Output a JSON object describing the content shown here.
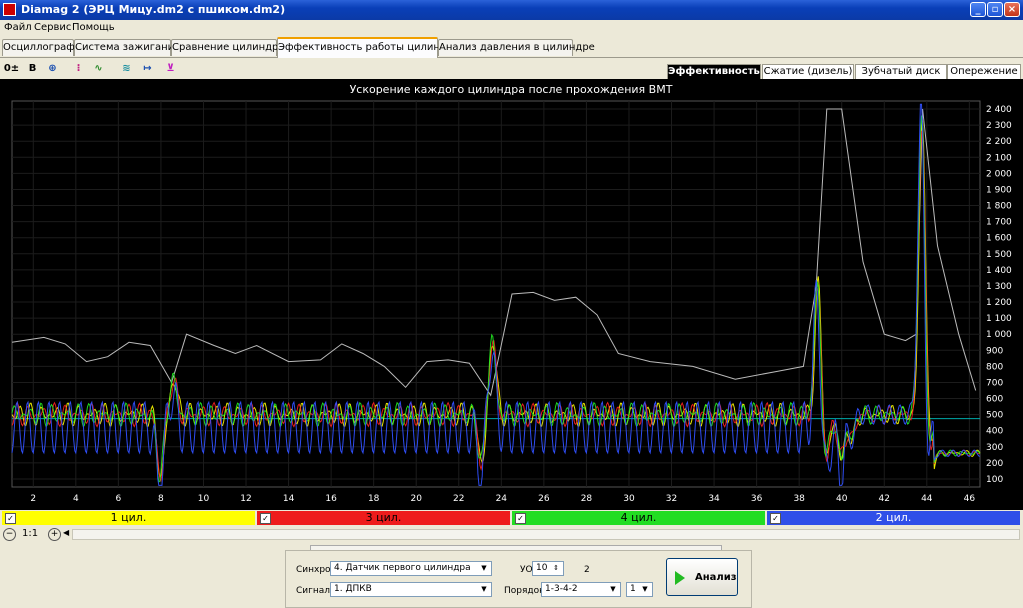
{
  "window": {
    "title": "Diamag 2 (ЭРЦ Мицу.dm2 с пшиком.dm2)"
  },
  "menu": [
    "Файл",
    "Сервис",
    "Помощь"
  ],
  "tabs": [
    "Осциллограф",
    "Система зажигания",
    "Сравнение цилиндров",
    "Эффективность работы цилиндров",
    "Анализ давления в цилиндре"
  ],
  "active_tab": "Эффективность работы цилиндров",
  "right_tabs": [
    "Эффективность",
    "Сжатие (дизель)",
    "Зубчатый диск",
    "Опережение"
  ],
  "active_right_tab": "Эффективность",
  "chart_data": {
    "type": "line",
    "title": "Ускорение каждого цилиндра после прохождения ВМТ",
    "xlim": [
      1,
      46.5
    ],
    "ylim": [
      50,
      2450
    ],
    "x_ticks": [
      2,
      4,
      6,
      8,
      10,
      12,
      14,
      16,
      18,
      20,
      22,
      24,
      26,
      28,
      30,
      32,
      34,
      36,
      38,
      40,
      42,
      44,
      46
    ],
    "y_ticks": [
      "2 400",
      "2 300",
      "2 200",
      "2 100",
      "2 000",
      "1 900",
      "1 800",
      "1 700",
      "1 600",
      "1 500",
      "1 400",
      "1 300",
      "1 200",
      "1 100",
      "1 000",
      "900",
      "800",
      "700",
      "600",
      "500",
      "400",
      "300",
      "200",
      "100"
    ],
    "series": [
      {
        "name": "1 цил.",
        "color": "#ffff00"
      },
      {
        "name": "3 цил.",
        "color": "#ff2020"
      },
      {
        "name": "4 цил.",
        "color": "#22ee22"
      },
      {
        "name": "2 цил.",
        "color": "#3050ff"
      }
    ],
    "envelope": {
      "color": "#bbbbbb",
      "x": [
        1,
        2.5,
        3.5,
        4.5,
        5.5,
        6.5,
        7.5,
        8.5,
        9.2,
        10.5,
        11.5,
        12.5,
        14,
        15.5,
        16.5,
        17.5,
        18.5,
        19.5,
        20.5,
        21.5,
        22.5,
        23.5,
        24.5,
        25.5,
        26.5,
        27.5,
        28.5,
        29.5,
        31,
        33,
        35,
        37,
        38.2,
        38.8,
        39.3,
        40,
        41,
        42,
        43,
        43.5,
        43.8,
        44.5,
        45.5,
        46.3
      ],
      "y": [
        950,
        980,
        940,
        830,
        860,
        950,
        930,
        700,
        1000,
        930,
        880,
        930,
        830,
        840,
        940,
        880,
        800,
        670,
        830,
        840,
        820,
        620,
        1250,
        1260,
        1210,
        1230,
        1120,
        880,
        830,
        800,
        720,
        770,
        800,
        1300,
        2400,
        2400,
        1450,
        1000,
        960,
        1000,
        2400,
        1550,
        1000,
        650
      ]
    },
    "reference_line": {
      "value": 475,
      "color": "#00aaaa"
    },
    "noise": {
      "base": 500,
      "amp": 75,
      "blue_base": 420,
      "blue_amp": 160,
      "period": 0.5
    }
  },
  "legend": [
    {
      "label": "1 цил.",
      "color": "#ffff00",
      "checked": true
    },
    {
      "label": "3 цил.",
      "color": "#ff2020",
      "checked": true
    },
    {
      "label": "4 цил.",
      "color": "#22ee22",
      "checked": true
    },
    {
      "label": "2 цил.",
      "color": "#3050ff",
      "checked": true
    }
  ],
  "zoom": "1:1",
  "controls": {
    "sync_label": "Синхро:",
    "sync_value": "4. Датчик первого цилиндра",
    "signal_label": "Сигнал:",
    "signal_value": "1. ДПКВ",
    "uoz_label": "УОЗ",
    "uoz_value": "10",
    "uoz_extra": "2",
    "order_label": "Порядок",
    "order_value": "1-3-4-2",
    "order_extra": "1",
    "analyze_label": "Анализ"
  }
}
